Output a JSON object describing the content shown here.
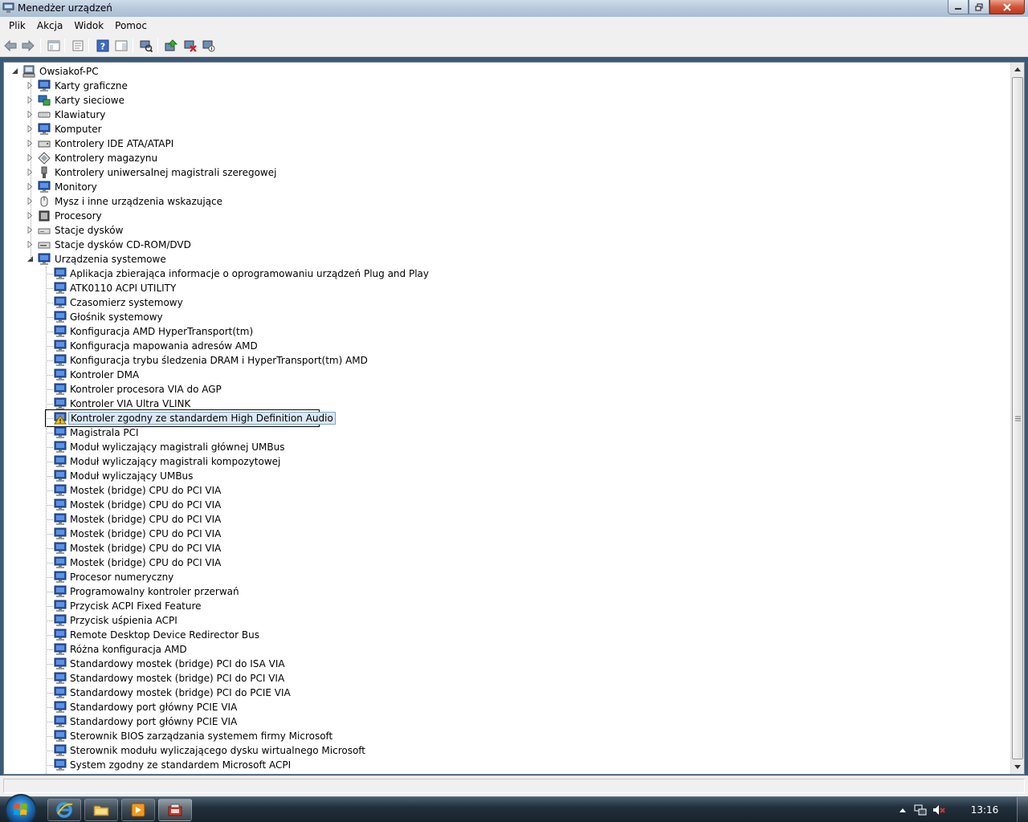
{
  "window": {
    "title": "Menedżer urządzeń"
  },
  "menubar": {
    "items": [
      "Plik",
      "Akcja",
      "Widok",
      "Pomoc"
    ]
  },
  "toolbar": {
    "buttons": [
      "back-icon",
      "forward-icon",
      "console-tree-icon",
      "properties-icon",
      "help-icon",
      "action-pane-icon",
      "scan-hardware-icon",
      "update-driver-icon",
      "uninstall-icon",
      "disable-icon"
    ]
  },
  "tree": {
    "root": "Owsiakof-PC",
    "categories": [
      {
        "label": "Karty graficzne",
        "icon": "display-adapter-icon"
      },
      {
        "label": "Karty sieciowe",
        "icon": "network-adapter-icon"
      },
      {
        "label": "Klawiatury",
        "icon": "keyboard-icon"
      },
      {
        "label": "Komputer",
        "icon": "computer-icon"
      },
      {
        "label": "Kontrolery IDE ATA/ATAPI",
        "icon": "ide-controller-icon"
      },
      {
        "label": "Kontrolery magazynu",
        "icon": "storage-controller-icon"
      },
      {
        "label": "Kontrolery uniwersalnej magistrali szeregowej",
        "icon": "usb-icon"
      },
      {
        "label": "Monitory",
        "icon": "monitor-icon"
      },
      {
        "label": "Mysz i inne urządzenia wskazujące",
        "icon": "mouse-icon"
      },
      {
        "label": "Procesory",
        "icon": "processor-icon"
      },
      {
        "label": "Stacje dysków",
        "icon": "disk-drive-icon"
      },
      {
        "label": "Stacje dysków CD-ROM/DVD",
        "icon": "cdrom-icon"
      },
      {
        "label": "Urządzenia systemowe",
        "icon": "system-device-icon"
      }
    ],
    "system_devices": [
      "Aplikacja zbierająca informacje o oprogramowaniu urządzeń Plug and Play",
      "ATK0110 ACPI UTILITY",
      "Czasomierz systemowy",
      "Głośnik systemowy",
      "Konfiguracja AMD HyperTransport(tm)",
      "Konfiguracja mapowania adresów AMD",
      "Konfiguracja trybu śledzenia DRAM i HyperTransport(tm) AMD",
      "Kontroler DMA",
      "Kontroler procesora VIA do AGP",
      "Kontroler VIA Ultra VLINK",
      "Kontroler zgodny ze standardem High Definition Audio",
      "Magistrala PCI",
      "Moduł wyliczający magistrali głównej UMBus",
      "Moduł wyliczający magistrali kompozytowej",
      "Moduł wyliczający UMBus",
      "Mostek (bridge) CPU do PCI VIA",
      "Mostek (bridge) CPU do PCI VIA",
      "Mostek (bridge) CPU do PCI VIA",
      "Mostek (bridge) CPU do PCI VIA",
      "Mostek (bridge) CPU do PCI VIA",
      "Mostek (bridge) CPU do PCI VIA",
      "Procesor numeryczny",
      "Programowalny kontroler przerwań",
      "Przycisk ACPI Fixed Feature",
      "Przycisk uśpienia ACPI",
      "Remote Desktop Device Redirector Bus",
      "Różna konfiguracja AMD",
      "Standardowy mostek (bridge) PCI do ISA VIA",
      "Standardowy mostek (bridge) PCI do PCI VIA",
      "Standardowy mostek (bridge) PCI do PCIE VIA",
      "Standardowy port główny PCIE VIA",
      "Standardowy port główny PCIE VIA",
      "Sterownik BIOS zarządzania systemem firmy Microsoft",
      "Sterownik modułu wyliczającego dysku wirtualnego Microsoft",
      "System zgodny ze standardem Microsoft ACPI"
    ],
    "selected_index": 10,
    "warning_index": 10
  },
  "taskbar": {
    "clock": "13:16",
    "buttons": [
      "internet-explorer-icon",
      "explorer-folder-icon",
      "media-player-icon",
      "device-manager-icon"
    ],
    "active_button": 3
  },
  "colors": {
    "selection_fill": "#dbe9f7",
    "selection_border": "#7da2ce",
    "warning": "#f5c400"
  }
}
